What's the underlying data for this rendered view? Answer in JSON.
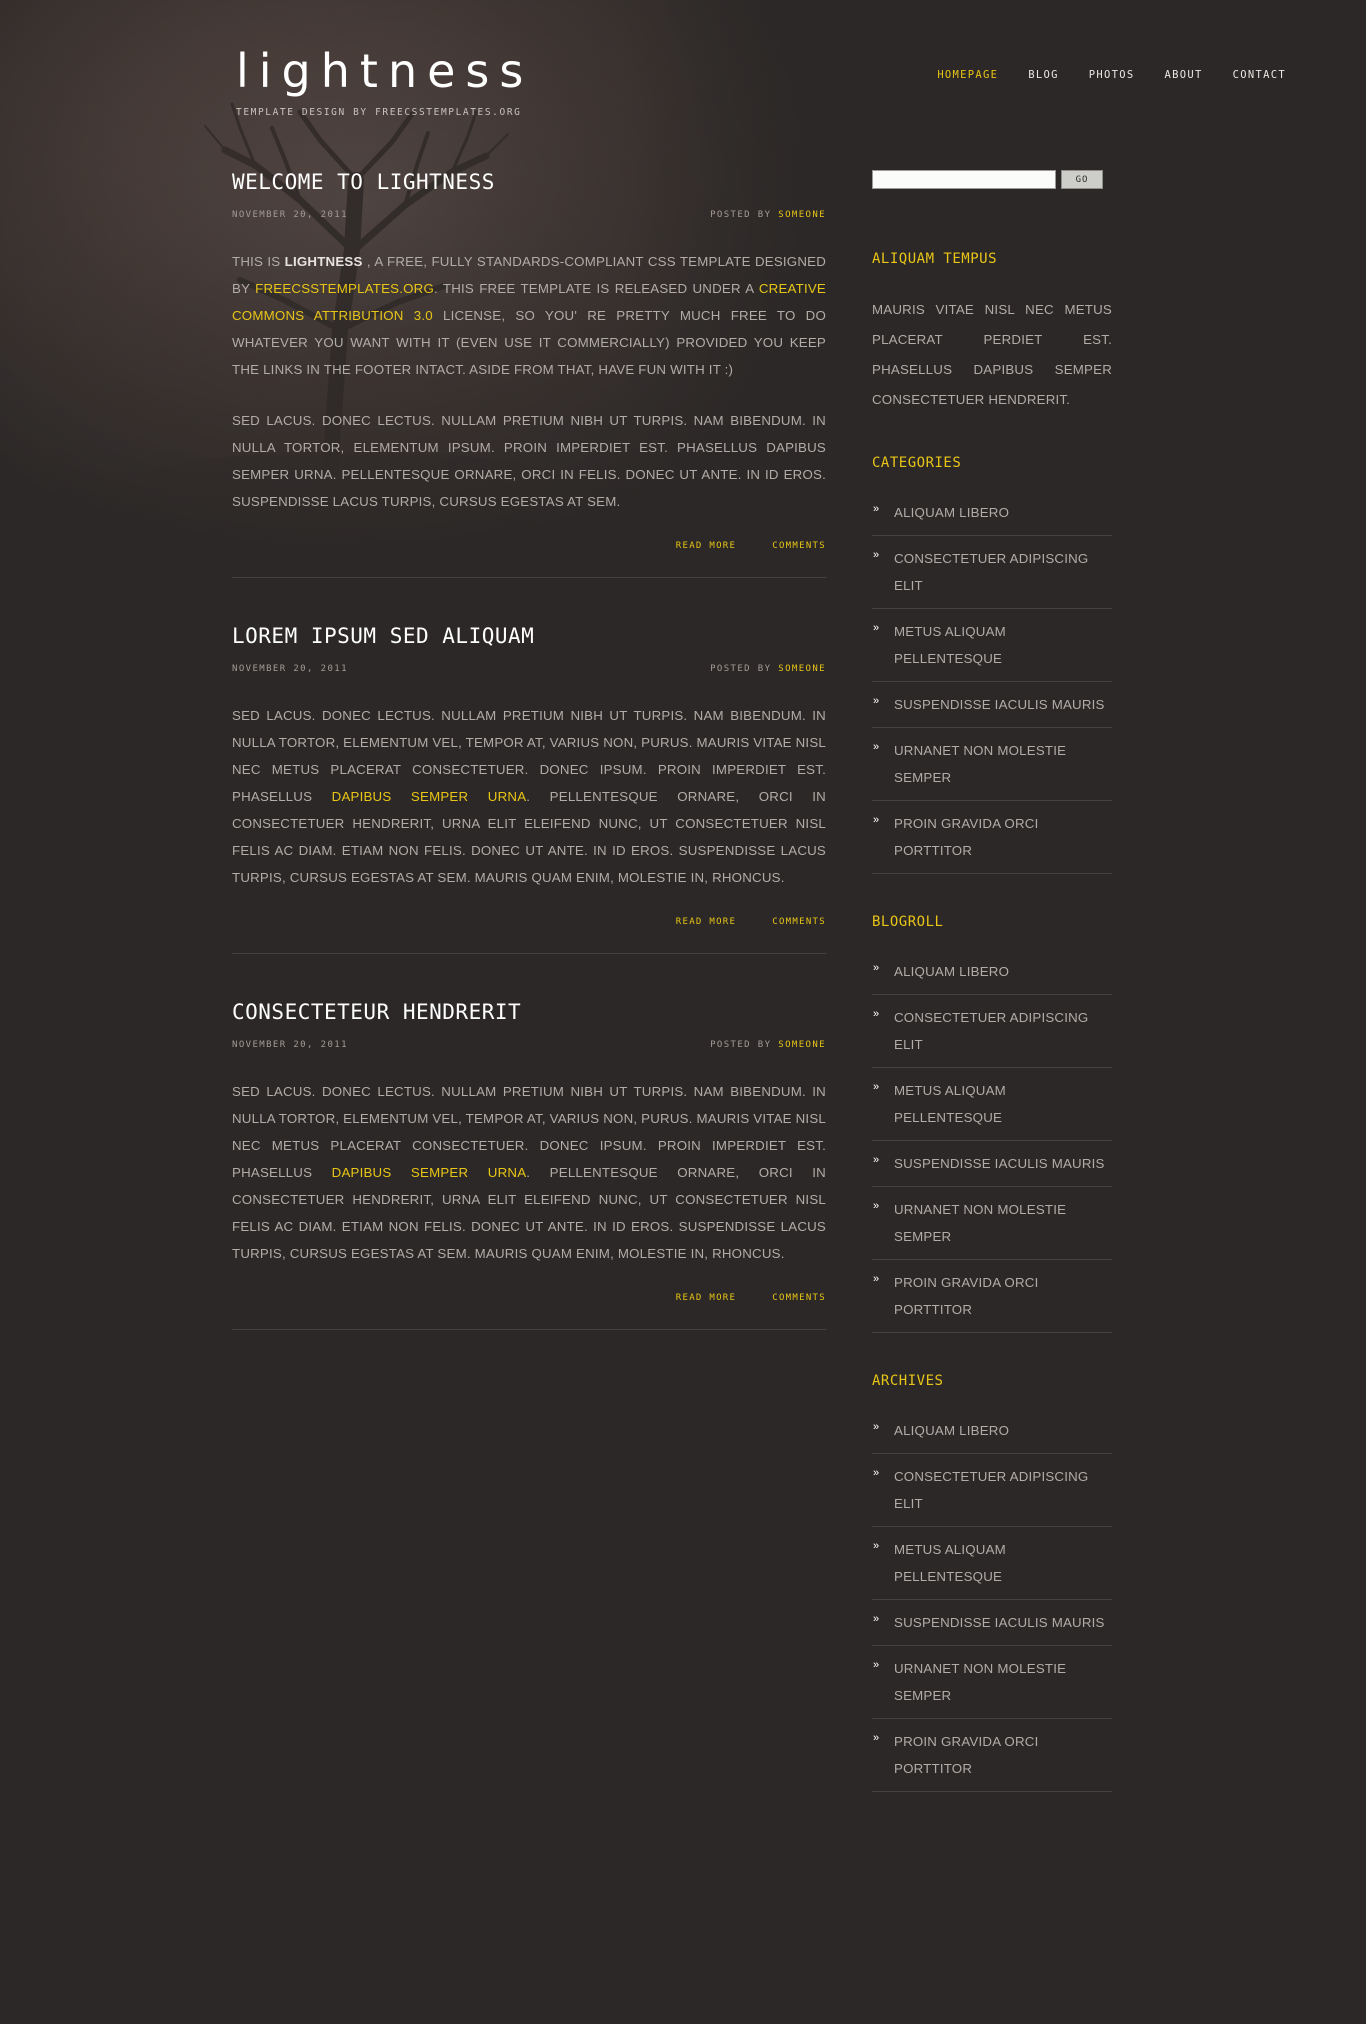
{
  "site": {
    "logo": "lightness",
    "tagline": "TEMPLATE DESIGN BY FREECSSTEMPLATES.ORG"
  },
  "colors": {
    "background": "#2b2827",
    "accent": "#e8c517",
    "text": "#b2aca8",
    "heading": "#ffffff",
    "rule": "#474240"
  },
  "nav": {
    "items": [
      {
        "label": "HOMEPAGE",
        "active": true
      },
      {
        "label": "BLOG",
        "active": false
      },
      {
        "label": "PHOTOS",
        "active": false
      },
      {
        "label": "ABOUT",
        "active": false
      },
      {
        "label": "CONTACT",
        "active": false
      }
    ]
  },
  "search": {
    "value": "",
    "placeholder": "",
    "button_label": "GO"
  },
  "posts": [
    {
      "title": "WELCOME TO LIGHTNESS",
      "date": "NOVEMBER 20, 2011",
      "posted_by_label": "POSTED BY",
      "author": "SOMEONE",
      "paragraph1": {
        "a": "THIS IS ",
        "strong": "LIGHTNESS",
        "b": " , A FREE, FULLY STANDARDS-COMPLIANT CSS TEMPLATE DESIGNED BY ",
        "link1": "FREECSSTEMPLATES.ORG",
        "c": ". THIS FREE TEMPLATE IS RELEASED UNDER A ",
        "link2": "CREATIVE COMMONS ATTRIBUTION 3.0",
        "d": " LICENSE, SO YOU' RE PRETTY MUCH FREE TO DO WHATEVER YOU WANT WITH IT (EVEN USE IT COMMERCIALLY) PROVIDED YOU KEEP THE LINKS IN THE FOOTER INTACT. ASIDE FROM THAT, HAVE FUN WITH IT :)"
      },
      "paragraph2": "SED LACUS. DONEC LECTUS. NULLAM PRETIUM NIBH UT TURPIS. NAM BIBENDUM. IN NULLA TORTOR, ELEMENTUM IPSUM. PROIN IMPERDIET EST. PHASELLUS DAPIBUS SEMPER URNA. PELLENTESQUE ORNARE, ORCI IN FELIS. DONEC UT ANTE. IN ID EROS. SUSPENDISSE LACUS TURPIS, CURSUS EGESTAS AT SEM.",
      "read_more": "READ MORE",
      "comments": "COMMENTS"
    },
    {
      "title": "LOREM IPSUM SED ALIQUAM",
      "date": "NOVEMBER 20, 2011",
      "posted_by_label": "POSTED BY",
      "author": "SOMEONE",
      "body_a": "SED LACUS. DONEC LECTUS. NULLAM PRETIUM NIBH UT TURPIS. NAM BIBENDUM. IN NULLA TORTOR, ELEMENTUM VEL, TEMPOR AT, VARIUS NON, PURUS. MAURIS VITAE NISL NEC METUS PLACERAT CONSECTETUER. DONEC IPSUM. PROIN IMPERDIET EST. PHASELLUS ",
      "body_link": "DAPIBUS SEMPER URNA",
      "body_b": ". PELLENTESQUE ORNARE, ORCI IN CONSECTETUER HENDRERIT, URNA ELIT ELEIFEND NUNC, UT CONSECTETUER NISL FELIS AC DIAM. ETIAM NON FELIS. DONEC UT ANTE. IN ID EROS. SUSPENDISSE LACUS TURPIS, CURSUS EGESTAS AT SEM. MAURIS QUAM ENIM, MOLESTIE IN, RHONCUS.",
      "read_more": "READ MORE",
      "comments": "COMMENTS"
    },
    {
      "title": "CONSECTETEUR HENDRERIT",
      "date": "NOVEMBER 20, 2011",
      "posted_by_label": "POSTED BY",
      "author": "SOMEONE",
      "body_a": "SED LACUS. DONEC LECTUS. NULLAM PRETIUM NIBH UT TURPIS. NAM BIBENDUM. IN NULLA TORTOR, ELEMENTUM VEL, TEMPOR AT, VARIUS NON, PURUS. MAURIS VITAE NISL NEC METUS PLACERAT CONSECTETUER. DONEC IPSUM. PROIN IMPERDIET EST. PHASELLUS ",
      "body_link": "DAPIBUS SEMPER URNA",
      "body_b": ". PELLENTESQUE ORNARE, ORCI IN CONSECTETUER HENDRERIT, URNA ELIT ELEIFEND NUNC, UT CONSECTETUER NISL FELIS AC DIAM. ETIAM NON FELIS. DONEC UT ANTE. IN ID EROS. SUSPENDISSE LACUS TURPIS, CURSUS EGESTAS AT SEM. MAURIS QUAM ENIM, MOLESTIE IN, RHONCUS.",
      "read_more": "READ MORE",
      "comments": "COMMENTS"
    }
  ],
  "sidebar": {
    "blocks": [
      {
        "title": "ALIQUAM TEMPUS",
        "type": "text",
        "text": "MAURIS VITAE NISL NEC METUS PLACERAT PERDIET EST. PHASELLUS DAPIBUS SEMPER CONSECTETUER HENDRERIT."
      },
      {
        "title": "CATEGORIES",
        "type": "list",
        "bullet": "»",
        "items": [
          "ALIQUAM LIBERO",
          "CONSECTETUER ADIPISCING ELIT",
          "METUS ALIQUAM PELLENTESQUE",
          "SUSPENDISSE IACULIS MAURIS",
          "URNANET NON MOLESTIE SEMPER",
          "PROIN GRAVIDA ORCI PORTTITOR"
        ]
      },
      {
        "title": "BLOGROLL",
        "type": "list",
        "bullet": "»",
        "items": [
          "ALIQUAM LIBERO",
          "CONSECTETUER ADIPISCING ELIT",
          "METUS ALIQUAM PELLENTESQUE",
          "SUSPENDISSE IACULIS MAURIS",
          "URNANET NON MOLESTIE SEMPER",
          "PROIN GRAVIDA ORCI PORTTITOR"
        ]
      },
      {
        "title": "ARCHIVES",
        "type": "list",
        "bullet": "»",
        "items": [
          "ALIQUAM LIBERO",
          "CONSECTETUER ADIPISCING ELIT",
          "METUS ALIQUAM PELLENTESQUE",
          "SUSPENDISSE IACULIS MAURIS",
          "URNANET NON MOLESTIE SEMPER",
          "PROIN GRAVIDA ORCI PORTTITOR"
        ]
      }
    ]
  }
}
